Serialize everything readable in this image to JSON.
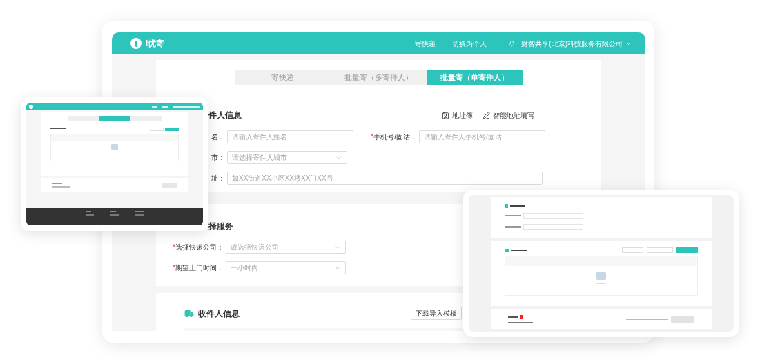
{
  "header": {
    "logo_text": "i优寄",
    "nav": [
      "寄快递",
      "切换为个人"
    ],
    "account": "财智共享(北京)科技服务有限公司"
  },
  "tabs": [
    {
      "label": "寄快递",
      "selected": false
    },
    {
      "label": "批量寄（多寄件人）",
      "selected": false
    },
    {
      "label": "批量寄（单寄件人）",
      "selected": true
    }
  ],
  "sender_section": {
    "title": "件人信息",
    "actions": [
      {
        "kind": "address_book",
        "label": "地址簿"
      },
      {
        "kind": "smart_fill",
        "label": "智能地址填写"
      }
    ],
    "rows": [
      [
        {
          "label": "名：",
          "kind": "text",
          "placeholder": "请输入寄件人姓名"
        },
        {
          "label": "手机号/固话：",
          "marker": "*",
          "kind": "text",
          "placeholder": "请输入寄件人手机号/固话"
        }
      ],
      [
        {
          "label": "市：",
          "kind": "select",
          "placeholder": "请选择寄件人城市"
        }
      ],
      [
        {
          "label": "址：",
          "kind": "text",
          "placeholder": "如XX街道XX小区XX楼XX门XX号"
        }
      ]
    ]
  },
  "service_section": {
    "title": "择服务",
    "rows": [
      [
        {
          "label": "选择快递公司：",
          "marker": "*",
          "kind": "select",
          "placeholder": "请选择快递公司"
        }
      ],
      [
        {
          "label": "期望上门时间：",
          "marker": "*",
          "kind": "select",
          "placeholder": "一小时内"
        }
      ]
    ]
  },
  "recipient_section": {
    "title": "收件人信息",
    "buttons": [
      "下载导入模板"
    ]
  }
}
